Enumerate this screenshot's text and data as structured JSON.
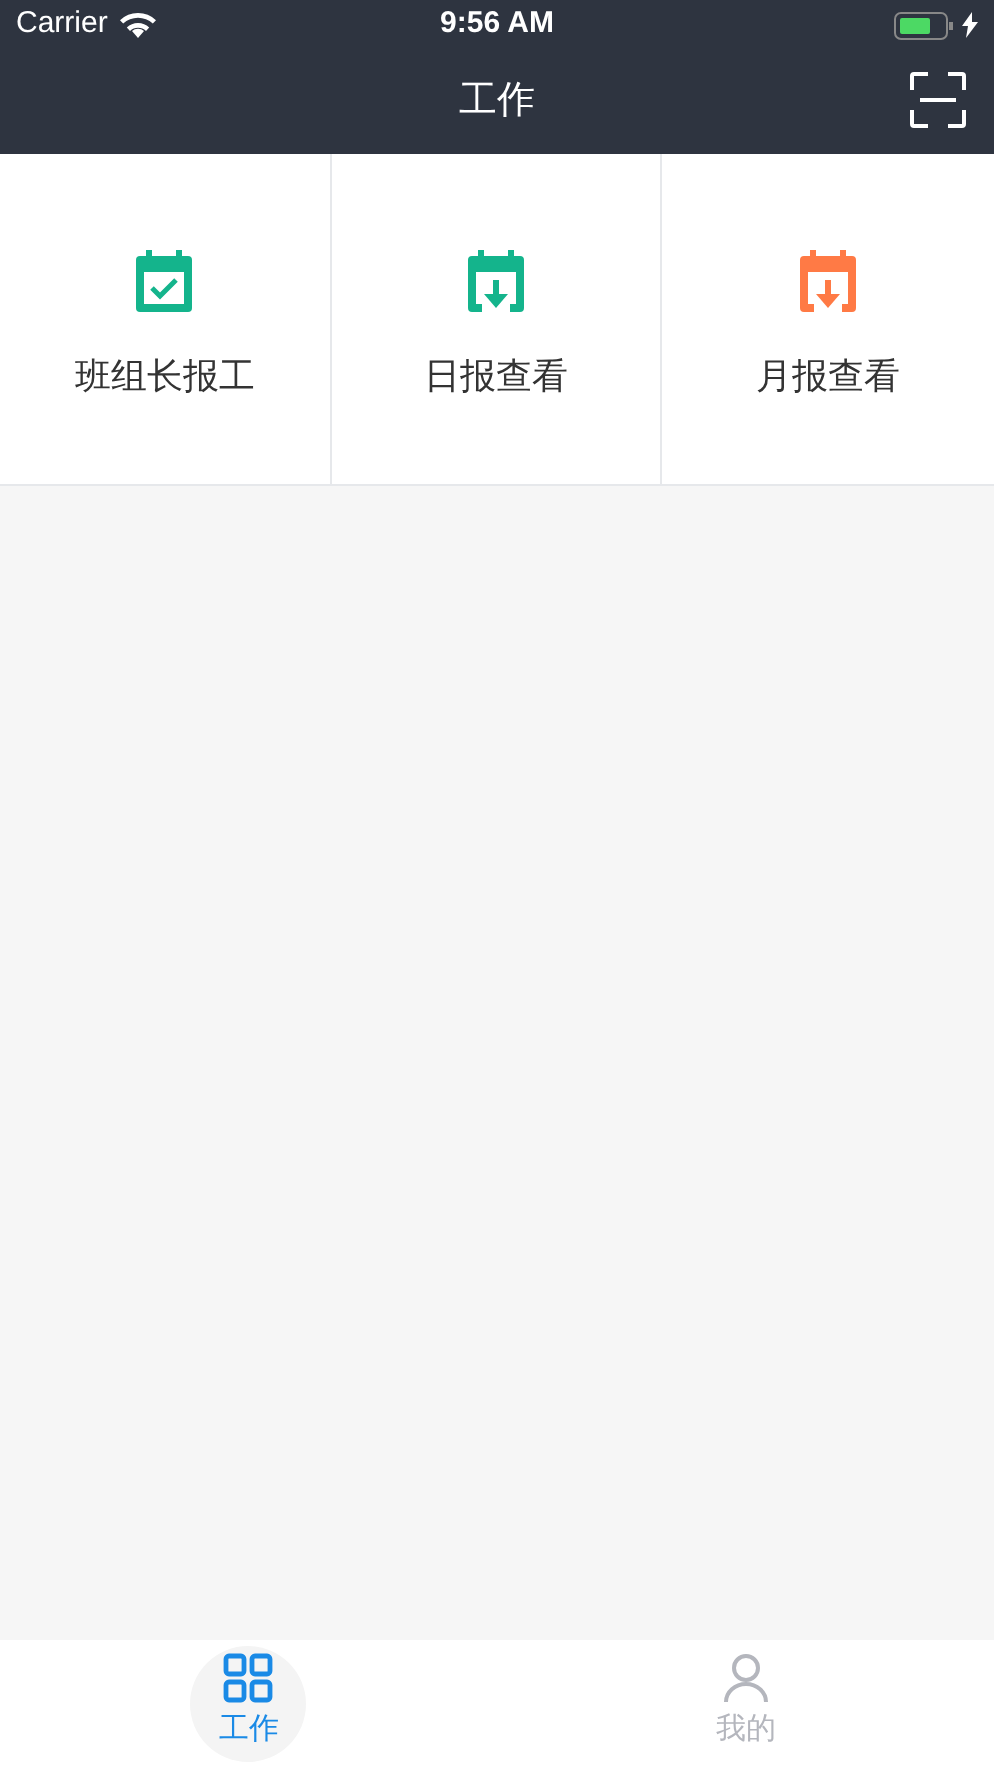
{
  "status_bar": {
    "carrier": "Carrier",
    "time": "9:56 AM"
  },
  "nav": {
    "title": "工作"
  },
  "grid": [
    {
      "label": "班组长报工",
      "kind": "check",
      "color": "#14b48c"
    },
    {
      "label": "日报查看",
      "kind": "download",
      "color": "#14b48c"
    },
    {
      "label": "月报查看",
      "kind": "download",
      "color": "#ff7a45"
    }
  ],
  "tabs": [
    {
      "label": "工作",
      "kind": "grid",
      "selected": true
    },
    {
      "label": "我的",
      "kind": "person",
      "selected": false
    }
  ]
}
